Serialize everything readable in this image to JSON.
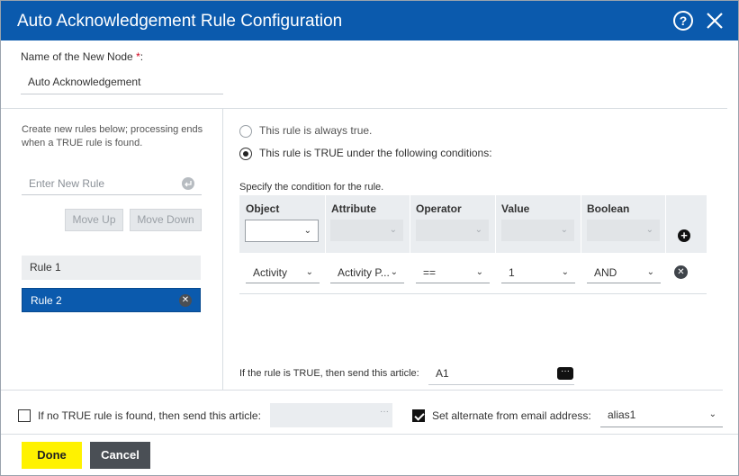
{
  "dialog": {
    "title": "Auto Acknowledgement Rule Configuration",
    "help_icon": "question-circle-icon",
    "help_glyph": "?",
    "close_icon": "close-icon"
  },
  "node_name": {
    "label": "Name of the New Node ",
    "required_mark": "*",
    "colon": ":",
    "value": "Auto Acknowledgement"
  },
  "rules_panel": {
    "help_text_line1": "Create new rules below; processing ends",
    "help_text_line2": "when a TRUE rule is found.",
    "new_rule_placeholder": "Enter New Rule",
    "enter_icon": "enter-icon",
    "move_up_label": "Move Up",
    "move_down_label": "Move Down",
    "rules": [
      {
        "label": "Rule 1",
        "selected": false
      },
      {
        "label": "Rule 2",
        "selected": true
      }
    ],
    "remove_glyph": "✕"
  },
  "rule_editor": {
    "always_true_label": "This rule is always true.",
    "conditional_label": "This rule is TRUE under the following conditions:",
    "selected_option": "conditional",
    "condition_hint": "Specify the condition for the rule.",
    "columns": [
      "Object",
      "Attribute",
      "Operator",
      "Value",
      "Boolean"
    ],
    "add_glyph": "+",
    "remove_glyph": "✕",
    "conditions": [
      {
        "object": "Activity",
        "attribute": "Activity P...",
        "operator": "==",
        "value": "1",
        "boolean": "AND"
      }
    ],
    "send_article_label": "If the rule is TRUE, then send this article:",
    "send_article_value": "A1",
    "ellipsis_glyph": "···"
  },
  "footer_options": {
    "no_true_rule_label": "If no TRUE rule is found, then send this article:",
    "no_true_rule_checked": false,
    "no_true_rule_value": "",
    "ellipsis_glyph": "···",
    "alternate_email_label": "Set alternate from email address:",
    "alternate_email_checked": true,
    "alternate_email_value": "alias1"
  },
  "actions": {
    "done_label": "Done",
    "cancel_label": "Cancel"
  },
  "colors": {
    "titlebar": "#0b5aad",
    "selected_rule": "#0b5aad",
    "done_button": "#fff200",
    "cancel_button": "#4a4f55"
  },
  "chevron_glyph": "⌄"
}
